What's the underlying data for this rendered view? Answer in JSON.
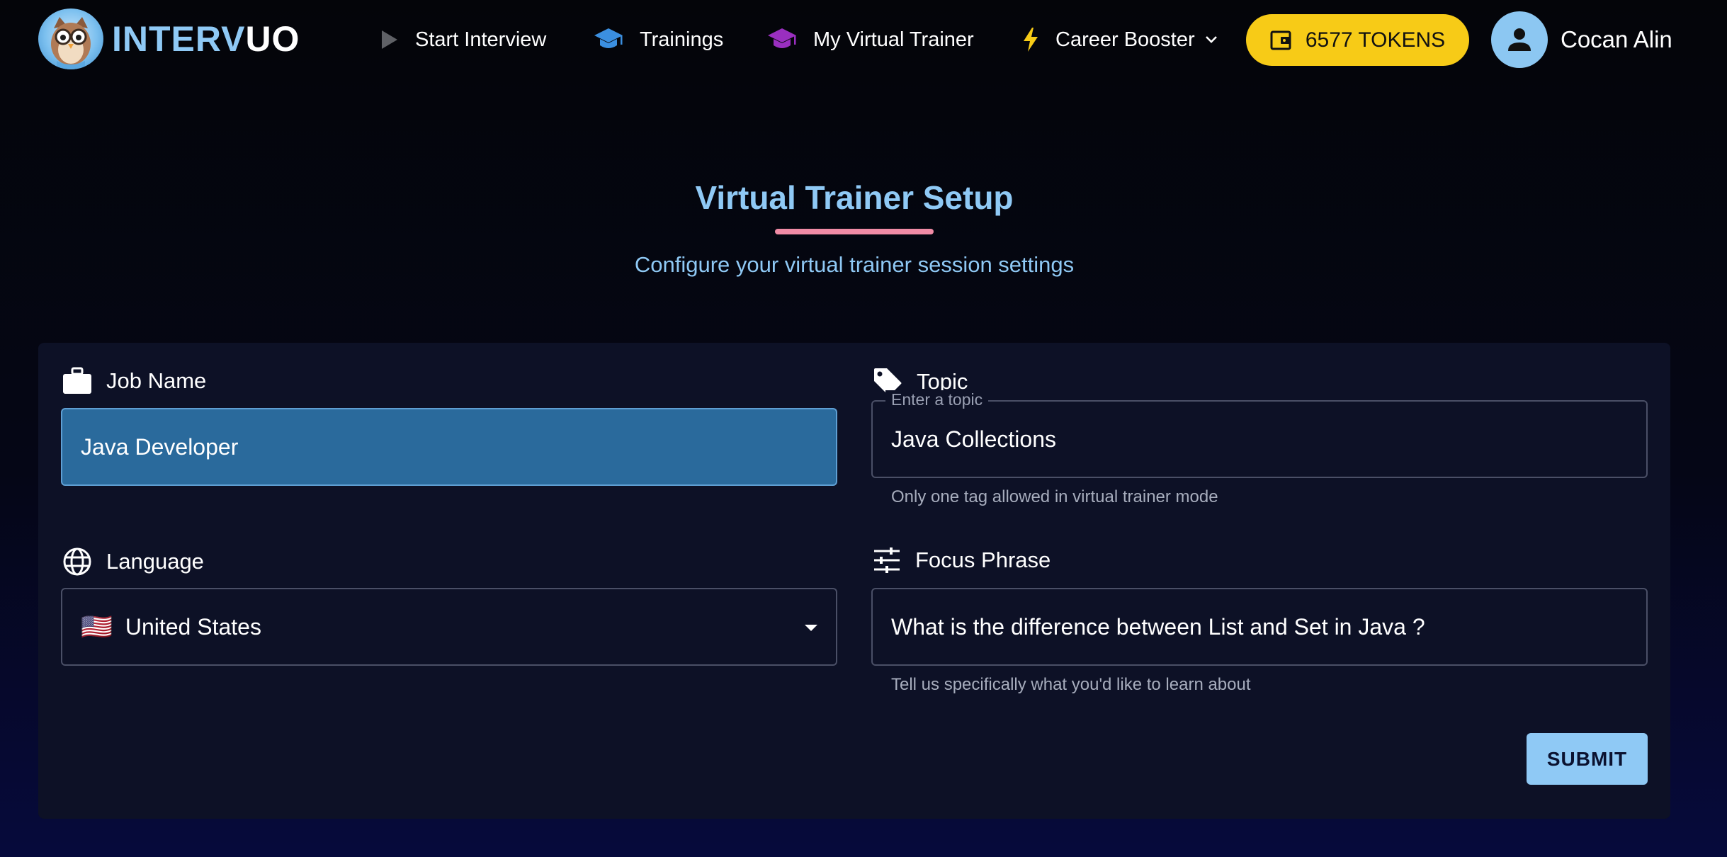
{
  "brand": {
    "part1": "INTERV",
    "part2": "UO",
    "accent": "#8fc9f5"
  },
  "nav": {
    "items": [
      {
        "label": "Start Interview",
        "icon": "play-icon"
      },
      {
        "label": "Trainings",
        "icon": "graduation-cap-icon"
      },
      {
        "label": "My Virtual Trainer",
        "icon": "graduation-cap-icon"
      },
      {
        "label": "Career Booster",
        "icon": "lightning-icon"
      }
    ],
    "tokens_label": "6577 TOKENS",
    "user_name": "Cocan Alin"
  },
  "header": {
    "title": "Virtual Trainer Setup",
    "subtitle": "Configure your virtual trainer session settings"
  },
  "form": {
    "job": {
      "label": "Job Name",
      "value": "Java Developer"
    },
    "topic": {
      "label": "Topic",
      "legend": "Enter a topic",
      "value": "Java Collections",
      "helper": "Only one tag allowed in virtual trainer mode"
    },
    "language": {
      "label": "Language",
      "flag": "🇺🇸",
      "value": "United States"
    },
    "focus": {
      "label": "Focus Phrase",
      "value": "What is the difference between List and Set in Java ?",
      "helper": "Tell us specifically what you'd like to learn about"
    },
    "submit_label": "SUBMIT"
  },
  "colors": {
    "tokens_bg": "#f7cb17",
    "job_input_bg": "#2a6a9c",
    "title": "#8fc9f5",
    "underline": "#f08ba5",
    "trainings_icon": "#3b8fe0",
    "virtual_trainer_icon": "#9a2fc0",
    "career_icon": "#f7cb17"
  }
}
